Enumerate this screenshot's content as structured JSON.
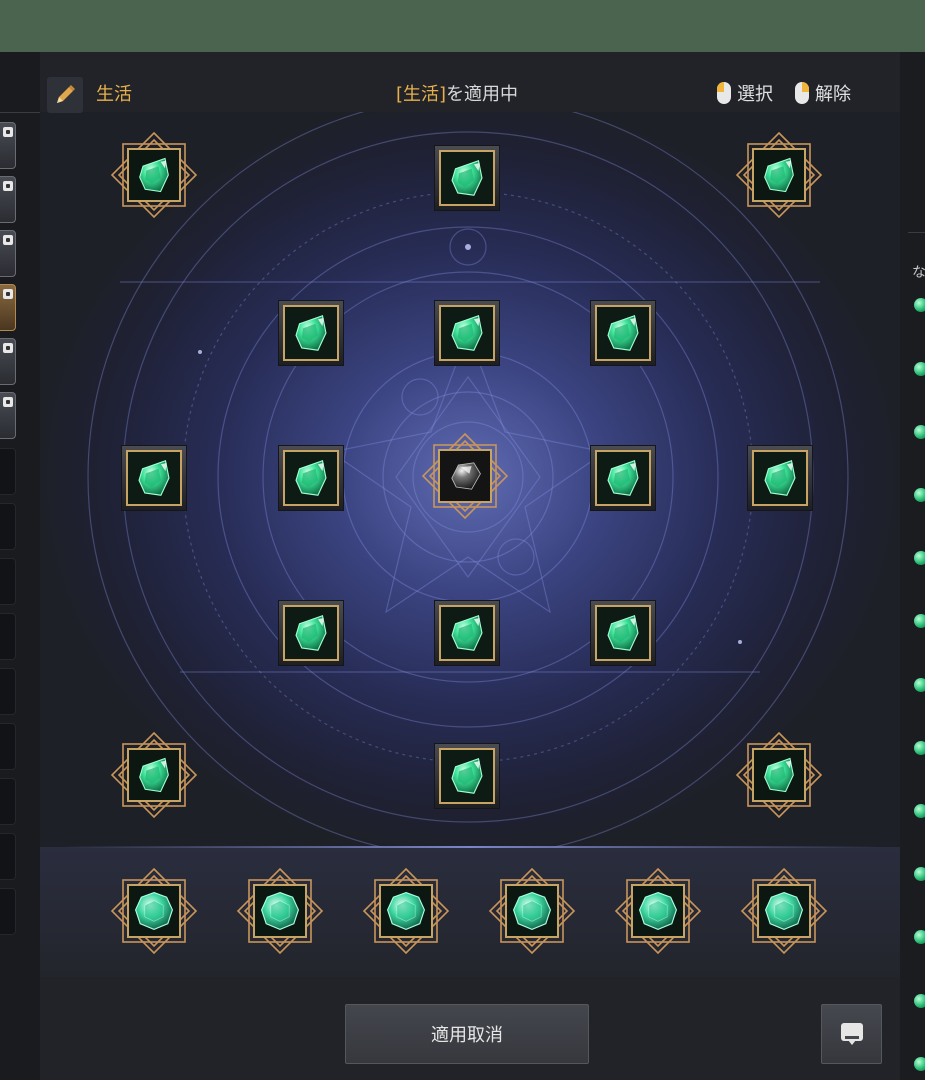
{
  "header": {
    "preset_label": "生活",
    "status_bracket_open": "[",
    "status_highlight": "生活",
    "status_bracket_close": "]",
    "status_suffix": "を適用中",
    "select_hint": "選択",
    "release_hint": "解除"
  },
  "right_panel": {
    "partial_label": "な"
  },
  "buttons": {
    "cancel_label": "適用取消"
  },
  "board": {
    "center_gem": "black-gem",
    "node_gem": "green-crystal",
    "bottom_gem": "green-round-gem",
    "bottom_gem_count": 6
  },
  "colors": {
    "accent_gold": "#e8b04a",
    "board_glow": "#5f6bb3",
    "gem_green": "#2fd58a",
    "topbar_green": "#4a644f"
  }
}
